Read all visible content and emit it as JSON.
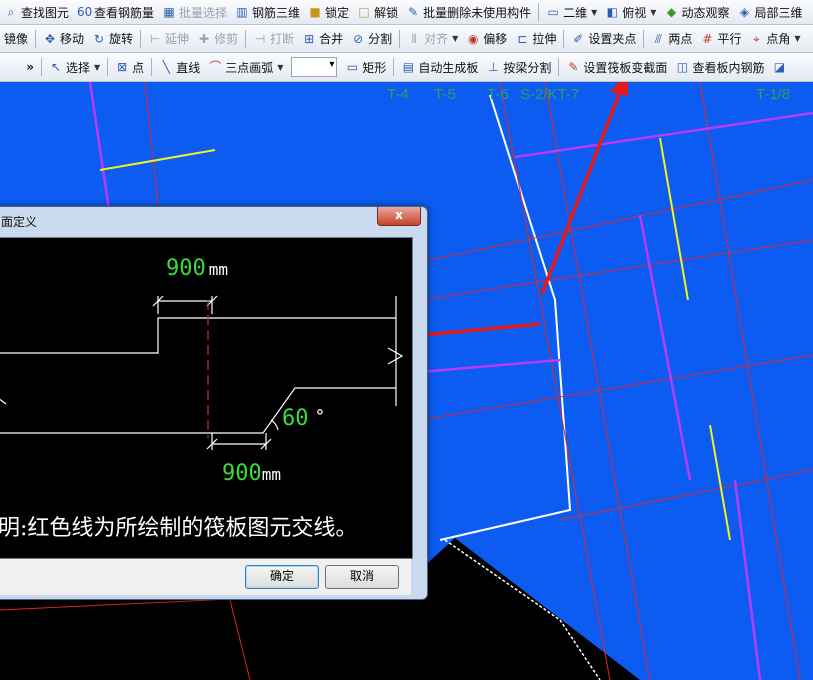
{
  "toolbar_row1": [
    {
      "label": "查找图元",
      "icon": "find-icon"
    },
    {
      "label": "查看钢筋量",
      "icon": "rebar-quantity-icon"
    },
    {
      "label": "批量选择",
      "icon": "batch-select-icon",
      "disabled": true
    },
    {
      "label": "钢筋三维",
      "icon": "rebar-3d-icon"
    },
    {
      "label": "锁定",
      "icon": "lock-icon"
    },
    {
      "label": "解锁",
      "icon": "unlock-icon"
    },
    {
      "label": "批量删除未使用构件",
      "icon": "batch-delete-icon"
    },
    {
      "label": "二维",
      "icon": "2d-view-icon"
    },
    {
      "label": "俯视",
      "icon": "top-view-icon"
    },
    {
      "label": "动态观察",
      "icon": "orbit-icon"
    },
    {
      "label": "局部三维",
      "icon": "local-3d-icon"
    }
  ],
  "toolbar_row2": [
    {
      "label": "镜像",
      "icon": "mirror-icon"
    },
    {
      "label": "移动",
      "icon": "move-icon"
    },
    {
      "label": "旋转",
      "icon": "rotate-icon"
    },
    {
      "label": "延伸",
      "icon": "extend-icon",
      "disabled": true
    },
    {
      "label": "修剪",
      "icon": "trim-icon",
      "disabled": true
    },
    {
      "label": "打断",
      "icon": "break-icon",
      "disabled": true
    },
    {
      "label": "合并",
      "icon": "merge-icon"
    },
    {
      "label": "分割",
      "icon": "split-icon"
    },
    {
      "label": "对齐",
      "icon": "align-icon",
      "disabled": true
    },
    {
      "label": "偏移",
      "icon": "offset-icon"
    },
    {
      "label": "拉伸",
      "icon": "stretch-icon"
    },
    {
      "label": "设置夹点",
      "icon": "grip-icon"
    },
    {
      "label": "两点",
      "icon": "two-point-icon"
    },
    {
      "label": "平行",
      "icon": "parallel-icon"
    },
    {
      "label": "点角",
      "icon": "point-angle-icon"
    }
  ],
  "toolbar_row3": [
    {
      "label": "选择",
      "icon": "select-arrow-icon"
    },
    {
      "label": "点",
      "icon": "point-icon"
    },
    {
      "label": "直线",
      "icon": "line-icon"
    },
    {
      "label": "三点画弧",
      "icon": "arc-icon"
    },
    {
      "label": "矩形",
      "icon": "rectangle-icon"
    },
    {
      "label": "自动生成板",
      "icon": "auto-slab-icon"
    },
    {
      "label": "按梁分割",
      "icon": "split-by-beam-icon"
    },
    {
      "label": "设置筏板变截面",
      "icon": "raft-section-icon"
    },
    {
      "label": "查看板内钢筋",
      "icon": "slab-rebar-icon"
    }
  ],
  "canvas": {
    "axis_labels": [
      "T-4",
      "T-5",
      "T-6",
      "S-2/KT-7",
      "T-1/8"
    ]
  },
  "dialog": {
    "title": "面定义",
    "close_label": "x",
    "dim_top_value": "900",
    "dim_top_unit": "mm",
    "dim_bottom_value": "900",
    "dim_bottom_unit": "mm",
    "angle_value": "60",
    "angle_unit": "°",
    "note": "明:红色线为所绘制的筏板图元交线。",
    "ok_label": "确定",
    "cancel_label": "取消"
  },
  "colors": {
    "canvas_bg": "#0c5cf2",
    "grid_red": "#e0272a",
    "beam_magenta": "#b83cff",
    "rebar_yellow": "#f2f21e",
    "dim_green": "#3adc3a",
    "arrow_red": "#e41b1b"
  }
}
